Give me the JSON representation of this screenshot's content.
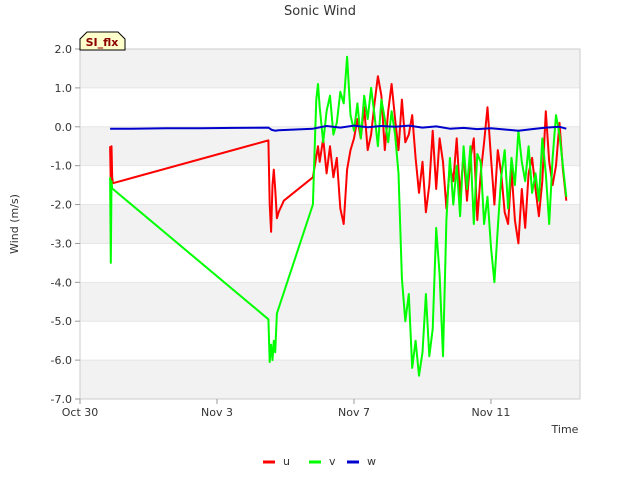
{
  "chart_data": {
    "type": "line",
    "title": "Sonic Wind",
    "badge": "SI_flx",
    "xlabel": "Time",
    "ylabel": "Wind (m/s)",
    "xlim": [
      0,
      14.6
    ],
    "ylim": [
      -7.0,
      2.0
    ],
    "x_ticks": [
      {
        "value": 0,
        "label": "Oct 30"
      },
      {
        "value": 4,
        "label": "Nov 3"
      },
      {
        "value": 8,
        "label": "Nov 7"
      },
      {
        "value": 12,
        "label": "Nov 11"
      }
    ],
    "y_ticks": [
      {
        "value": 2.0,
        "label": "2.0"
      },
      {
        "value": 1.0,
        "label": "1.0"
      },
      {
        "value": 0.0,
        "label": "0.0"
      },
      {
        "value": -1.0,
        "label": "-1.0"
      },
      {
        "value": -2.0,
        "label": "-2.0"
      },
      {
        "value": -3.0,
        "label": "-3.0"
      },
      {
        "value": -4.0,
        "label": "-4.0"
      },
      {
        "value": -5.0,
        "label": "-5.0"
      },
      {
        "value": -6.0,
        "label": "-6.0"
      },
      {
        "value": -7.0,
        "label": "-7.0"
      }
    ],
    "legend_position": "bottom",
    "series": [
      {
        "name": "u",
        "color": "#ff0000",
        "x": [
          0.88,
          0.9,
          0.92,
          0.94,
          0.96,
          5.5,
          5.54,
          5.58,
          5.62,
          5.66,
          5.7,
          5.75,
          5.8,
          5.85,
          5.9,
          5.95,
          6.8,
          6.95,
          7.0,
          7.1,
          7.2,
          7.3,
          7.4,
          7.5,
          7.6,
          7.7,
          7.8,
          7.9,
          8.0,
          8.1,
          8.2,
          8.3,
          8.4,
          8.5,
          8.6,
          8.7,
          8.8,
          8.9,
          9.0,
          9.1,
          9.2,
          9.3,
          9.4,
          9.5,
          9.6,
          9.7,
          9.8,
          9.9,
          10.0,
          10.1,
          10.2,
          10.3,
          10.4,
          10.5,
          10.6,
          10.7,
          10.8,
          10.9,
          11.0,
          11.1,
          11.2,
          11.3,
          11.4,
          11.5,
          11.6,
          11.7,
          11.8,
          11.9,
          12.0,
          12.1,
          12.2,
          12.3,
          12.4,
          12.5,
          12.6,
          12.7,
          12.8,
          12.9,
          13.0,
          13.1,
          13.2,
          13.3,
          13.4,
          13.5,
          13.6,
          13.7,
          13.8,
          13.9,
          14.0,
          14.1,
          14.2
        ],
        "y": [
          -0.5,
          -1.5,
          -0.5,
          -1.3,
          -1.45,
          -0.35,
          -2.0,
          -2.7,
          -1.5,
          -1.1,
          -1.6,
          -2.35,
          -2.2,
          -2.1,
          -2.0,
          -1.9,
          -1.3,
          -0.5,
          -0.9,
          -0.3,
          -1.2,
          -0.5,
          -1.3,
          -0.8,
          -2.1,
          -2.5,
          -1.1,
          -0.6,
          -0.3,
          0.2,
          -0.3,
          0.5,
          -0.6,
          -0.2,
          0.6,
          1.3,
          0.8,
          -0.6,
          0.4,
          1.1,
          0.2,
          -0.6,
          0.7,
          -0.4,
          -0.2,
          0.3,
          -0.8,
          -1.7,
          -0.9,
          -2.2,
          -1.5,
          -0.1,
          -1.6,
          -0.3,
          -0.9,
          -2.1,
          -1.0,
          -1.4,
          -0.3,
          -1.8,
          -0.7,
          -1.9,
          -0.8,
          -0.3,
          -2.4,
          -1.2,
          -0.4,
          0.5,
          -0.8,
          -2.0,
          -0.6,
          -1.2,
          -2.2,
          -2.5,
          -1.1,
          -2.4,
          -3.0,
          -1.6,
          -2.6,
          -1.2,
          -0.8,
          -1.6,
          -2.3,
          -1.4,
          0.4,
          -0.9,
          -1.5,
          -1.0,
          0.1,
          -1.1,
          -1.9
        ]
      },
      {
        "name": "v",
        "color": "#00ff00",
        "x": [
          0.88,
          0.9,
          0.92,
          0.94,
          0.96,
          5.5,
          5.54,
          5.58,
          5.62,
          5.66,
          5.7,
          5.75,
          6.8,
          6.85,
          6.9,
          6.95,
          7.0,
          7.1,
          7.2,
          7.3,
          7.4,
          7.5,
          7.6,
          7.7,
          7.8,
          7.9,
          8.0,
          8.1,
          8.2,
          8.3,
          8.4,
          8.5,
          8.6,
          8.7,
          8.8,
          8.9,
          9.0,
          9.1,
          9.2,
          9.3,
          9.4,
          9.5,
          9.6,
          9.7,
          9.8,
          9.9,
          10.0,
          10.1,
          10.2,
          10.3,
          10.4,
          10.5,
          10.6,
          10.7,
          10.8,
          10.9,
          11.0,
          11.1,
          11.2,
          11.3,
          11.4,
          11.5,
          11.6,
          11.7,
          11.8,
          11.9,
          12.0,
          12.1,
          12.2,
          12.3,
          12.4,
          12.5,
          12.6,
          12.7,
          12.8,
          12.9,
          13.0,
          13.1,
          13.2,
          13.3,
          13.4,
          13.5,
          13.6,
          13.7,
          13.8,
          13.9,
          14.0,
          14.1,
          14.2
        ],
        "y": [
          -1.3,
          -3.5,
          -1.4,
          -1.6,
          -1.6,
          -4.95,
          -6.05,
          -5.6,
          -6.0,
          -5.5,
          -5.8,
          -4.8,
          -2.0,
          -0.6,
          0.7,
          1.1,
          0.5,
          -0.4,
          0.4,
          0.8,
          -0.2,
          0.1,
          0.9,
          0.6,
          1.8,
          0.3,
          -0.1,
          0.6,
          -0.3,
          0.8,
          0.2,
          1.0,
          0.3,
          -0.5,
          0.7,
          0.2,
          -0.4,
          0.4,
          -0.2,
          -1.2,
          -3.9,
          -5.0,
          -4.3,
          -6.2,
          -5.5,
          -6.4,
          -5.8,
          -4.3,
          -5.9,
          -5.2,
          -2.6,
          -3.8,
          -5.9,
          -2.4,
          -0.8,
          -2.0,
          -1.0,
          -2.3,
          -0.5,
          -1.6,
          -0.5,
          -2.5,
          -0.7,
          -0.9,
          -2.5,
          -1.8,
          -3.1,
          -4.0,
          -2.6,
          -1.3,
          -0.6,
          -2.1,
          -0.8,
          -1.5,
          -0.1,
          -0.9,
          -1.4,
          -0.5,
          -1.7,
          -1.2,
          -1.9,
          -0.3,
          -1.2,
          -2.5,
          -0.8,
          0.3,
          -0.2,
          -1.0,
          -1.8
        ]
      },
      {
        "name": "w",
        "color": "#0000cc",
        "x": [
          0.88,
          1.5,
          2.5,
          3.5,
          4.5,
          5.5,
          5.6,
          5.7,
          5.8,
          6.3,
          6.8,
          7.2,
          7.6,
          8.0,
          8.4,
          8.8,
          9.2,
          9.6,
          10.0,
          10.4,
          10.8,
          11.2,
          11.6,
          12.0,
          12.4,
          12.8,
          13.2,
          13.6,
          14.0,
          14.2
        ],
        "y": [
          -0.05,
          -0.05,
          -0.04,
          -0.04,
          -0.03,
          -0.02,
          -0.08,
          -0.1,
          -0.09,
          -0.07,
          -0.05,
          0.02,
          -0.02,
          0.03,
          -0.01,
          0.02,
          0.0,
          0.03,
          -0.02,
          0.01,
          -0.05,
          -0.03,
          -0.06,
          -0.04,
          -0.07,
          -0.1,
          -0.06,
          -0.02,
          0.0,
          -0.05
        ]
      }
    ]
  }
}
